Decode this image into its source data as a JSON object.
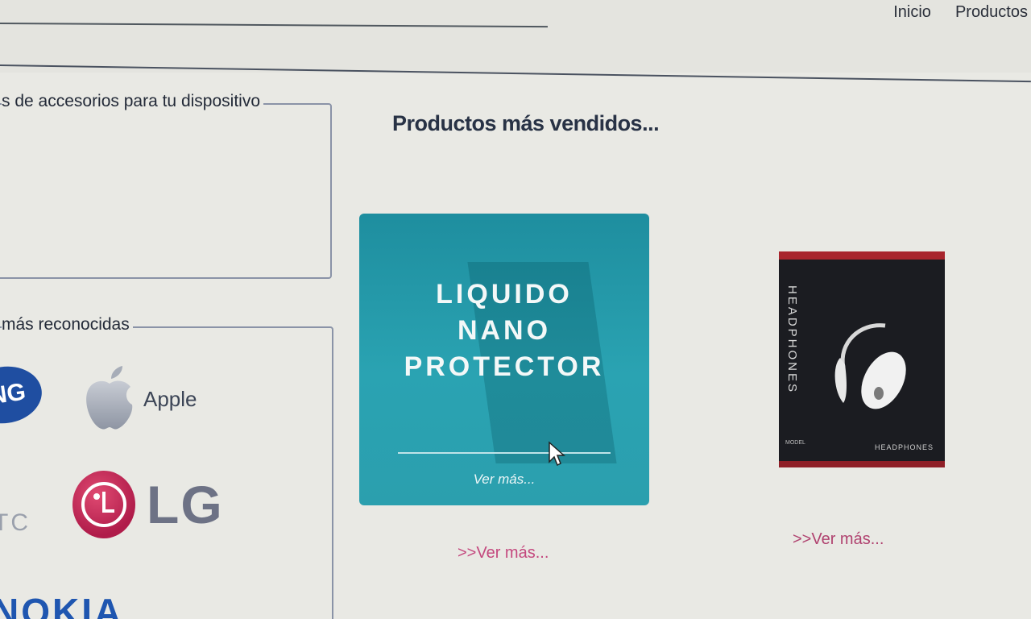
{
  "nav": {
    "items": [
      {
        "label": "Inicio"
      },
      {
        "label": "Productos"
      }
    ]
  },
  "panels": {
    "accessories_legend": "s de accesorios para tu dispositivo",
    "brands_legend": "más reconocidas"
  },
  "brands": {
    "samsung": "NG",
    "apple": "Apple",
    "lg": "LG",
    "htc": "TC",
    "nokia": "NOKIA"
  },
  "bestsellers": {
    "title": "Productos más vendidos...",
    "product_1": {
      "line1": "LIQUIDO",
      "line2": "NANO",
      "line3": "PROTECTOR",
      "card_link": "Ver más..."
    },
    "product_2": {
      "box_title": "HEADPHONES",
      "box_model": "MODEL",
      "box_bottom": "HEADPHONES"
    },
    "see_more_1": ">>Ver más...",
    "see_more_2": ">>Ver más..."
  },
  "colors": {
    "card_teal": "#2aa3b2",
    "link_pink": "#c4487e",
    "box_red": "#a8252d"
  }
}
